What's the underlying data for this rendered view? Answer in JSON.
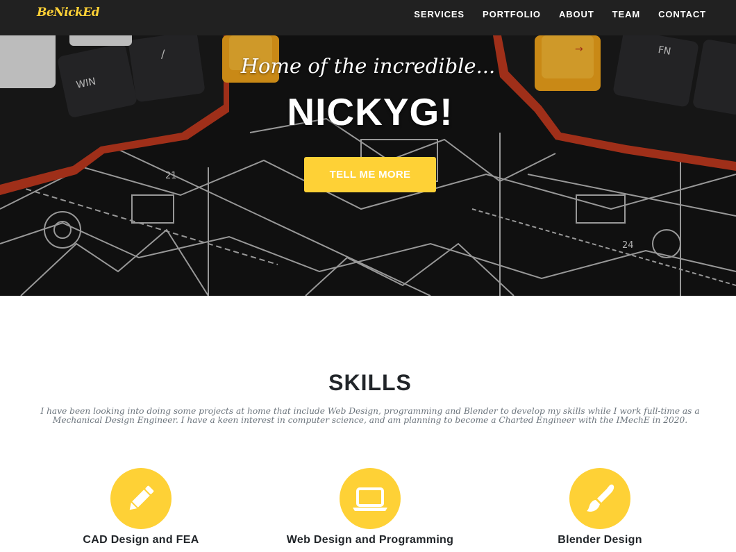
{
  "nav": {
    "brand": "BeNickEd",
    "links": [
      "SERVICES",
      "PORTFOLIO",
      "ABOUT",
      "TEAM",
      "CONTACT"
    ]
  },
  "hero": {
    "lead": "Home of the incredible...",
    "heading": "NICKYG!",
    "button": "TELL ME MORE"
  },
  "skills": {
    "heading": "SKILLS",
    "subheading": "I have been looking into doing some projects at home that include Web Design, programming and Blender to develop my skills while I work full-time as a Mechanical Design Engineer. I have a keen interest in computer science, and am planning to become a Charted Engineer with the IMechE in 2020.",
    "items": [
      {
        "title": "CAD Design and FEA",
        "icon": "pencil-icon"
      },
      {
        "title": "Web Design and Programming",
        "icon": "laptop-icon"
      },
      {
        "title": "Blender Design",
        "icon": "paintbrush-icon"
      }
    ]
  },
  "colors": {
    "accent": "#fed136",
    "navbar": "#212121",
    "heading": "#212529",
    "muted": "#6c757d"
  },
  "hero_image": {
    "keycap_labels": [
      "WIN",
      "/",
      "→",
      "FN"
    ],
    "blueprint_labels": [
      "21",
      "24"
    ]
  }
}
